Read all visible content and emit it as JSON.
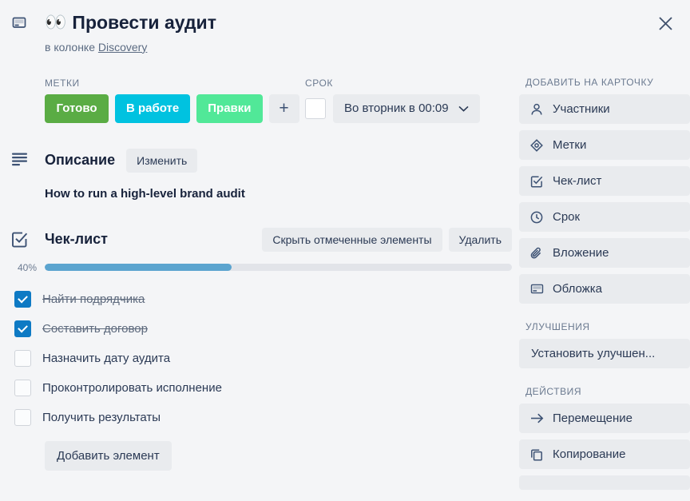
{
  "window": {
    "close_label": "×"
  },
  "header": {
    "gutter_icon": "cover-icon",
    "emoji": "👀",
    "title": "Провести аудит",
    "subtitle_prefix": "в колонке",
    "subtitle_link": "Discovery"
  },
  "labels": {
    "heading": "МЕТКИ",
    "chips": [
      {
        "text": "Готово",
        "color": "#5aac44"
      },
      {
        "text": "В работе",
        "color": "#00c2e0"
      },
      {
        "text": "Правки",
        "color": "#51e898"
      }
    ],
    "add_label": "+"
  },
  "due": {
    "heading": "СРОК",
    "checkbox_checked": false,
    "value": "Во вторник в 00:09",
    "chevron": "chevron-down-icon"
  },
  "description": {
    "gutter_icon": "description-icon",
    "title": "Описание",
    "edit_label": "Изменить",
    "body": "How to run a high-level brand audit"
  },
  "checklist": {
    "gutter_icon": "checklist-icon",
    "title": "Чек-лист",
    "hide_checked_label": "Скрыть отмеченные элементы",
    "delete_label": "Удалить",
    "progress_pct_label": "40%",
    "progress_pct": 40,
    "items": [
      {
        "text": "Найти подрядчика",
        "checked": true
      },
      {
        "text": "Составить договор",
        "checked": true
      },
      {
        "text": "Назначить дату аудита",
        "checked": false
      },
      {
        "text": "Проконтролировать исполнение",
        "checked": false
      },
      {
        "text": "Получить результаты",
        "checked": false
      }
    ],
    "add_item_label": "Добавить элемент"
  },
  "sidebar": {
    "groups": [
      {
        "heading": "ДОБАВИТЬ НА КАРТОЧКУ",
        "items": [
          {
            "label": "Участники",
            "icon": "person-icon"
          },
          {
            "label": "Метки",
            "icon": "tag-icon"
          },
          {
            "label": "Чек-лист",
            "icon": "checklist-icon"
          },
          {
            "label": "Срок",
            "icon": "clock-icon"
          },
          {
            "label": "Вложение",
            "icon": "paperclip-icon"
          },
          {
            "label": "Обложка",
            "icon": "cover-icon"
          }
        ]
      },
      {
        "heading": "УЛУЧШЕНИЯ",
        "items": [
          {
            "label": "Установить улучшен...",
            "icon": "none"
          }
        ]
      },
      {
        "heading": "ДЕЙСТВИЯ",
        "items": [
          {
            "label": "Перемещение",
            "icon": "arrow-right-icon"
          },
          {
            "label": "Копирование",
            "icon": "copy-icon"
          },
          {
            "label": "",
            "icon": "none"
          }
        ]
      }
    ]
  },
  "colors": {
    "page_bg": "#f4f5f7",
    "button_bg": "#e9ebee",
    "text": "#2b3a55",
    "muted": "#6b7a90",
    "checkbox_on": "#0e7ac4",
    "progress_fill": "#5ba4cf"
  }
}
